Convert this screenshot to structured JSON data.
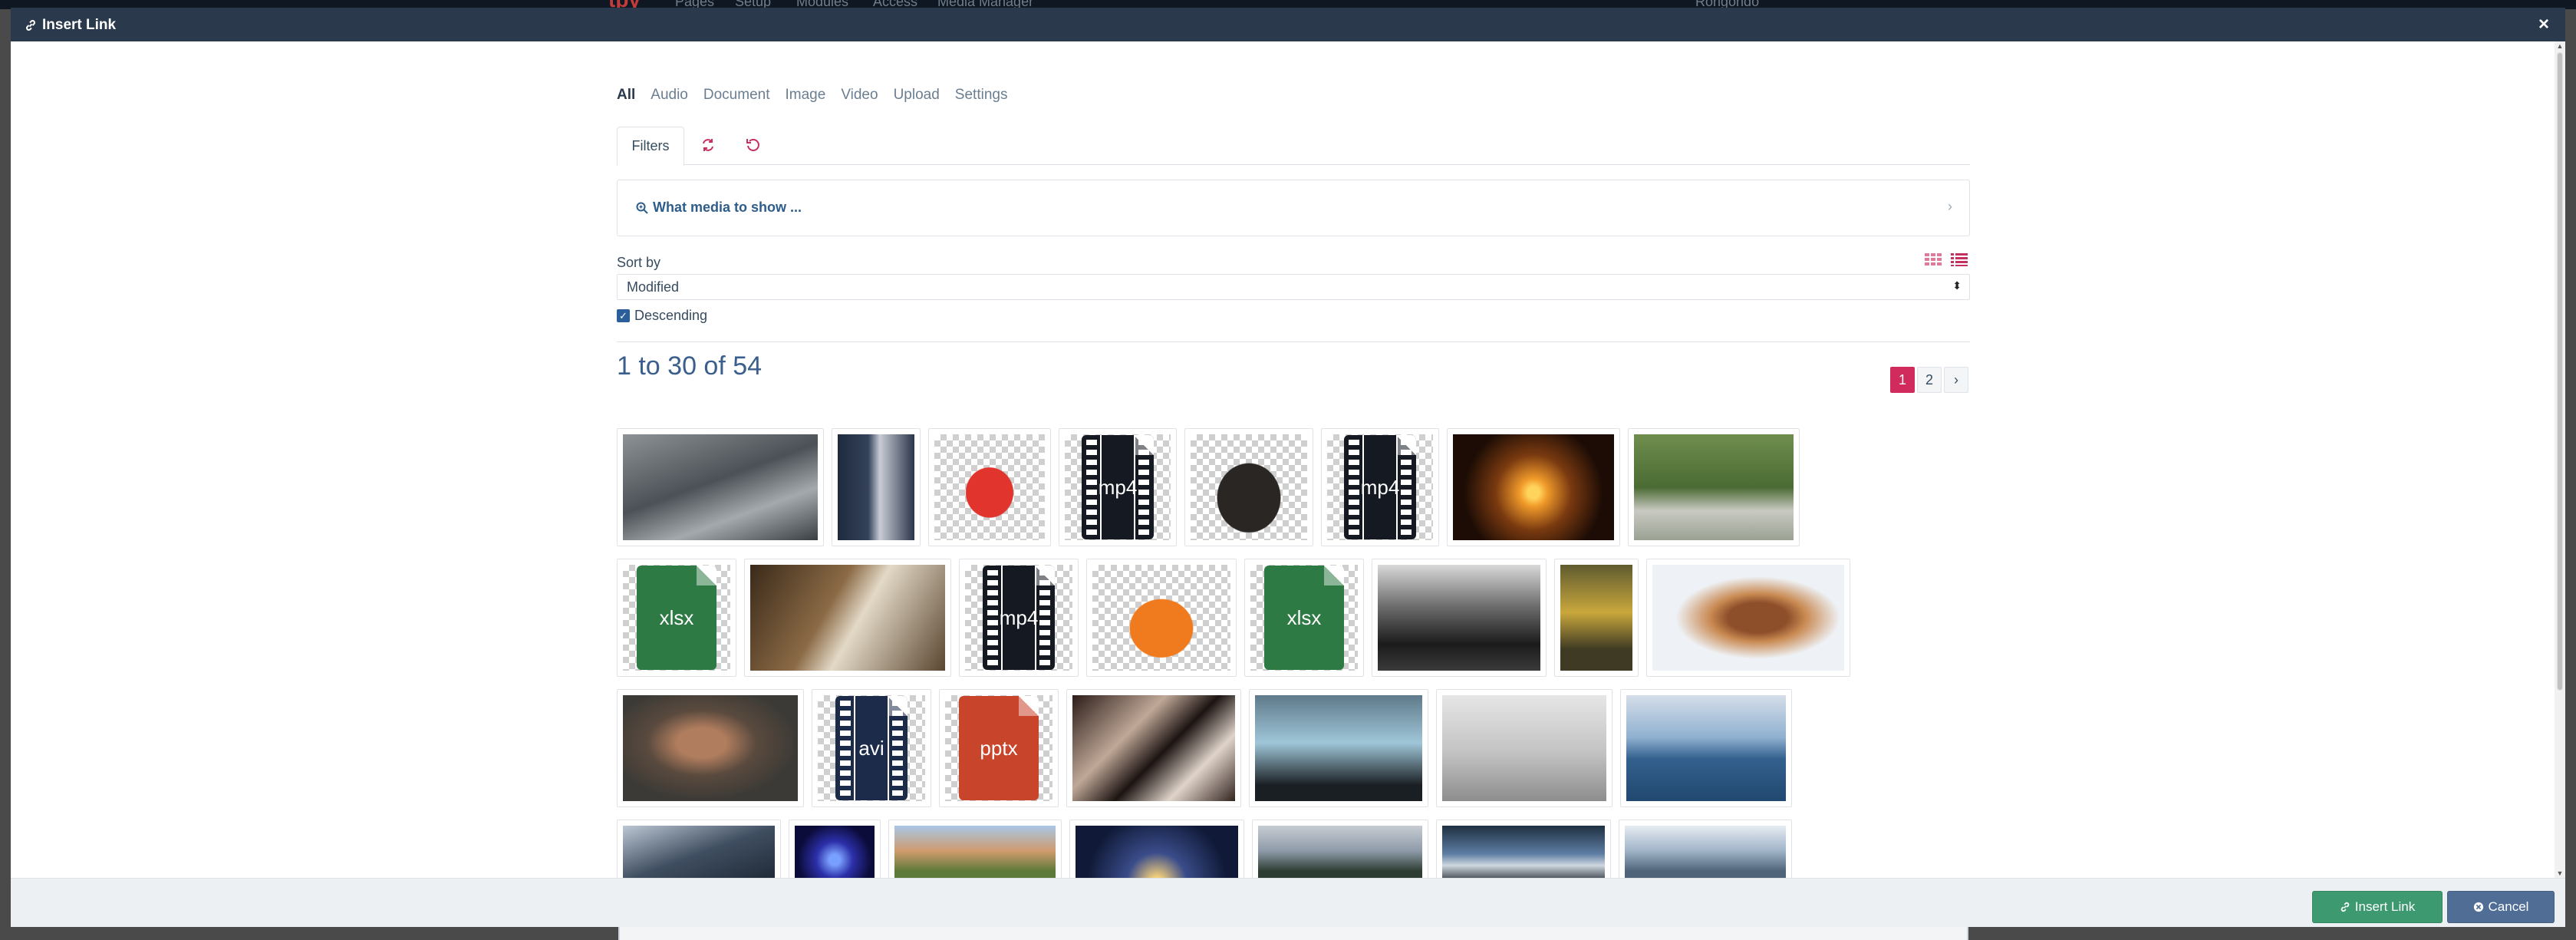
{
  "modal": {
    "title": "Insert Link",
    "close_symbol": "×"
  },
  "background_app": {
    "nav_items": [
      "Pages",
      "Setup",
      "Modules",
      "Access",
      "Media Manager"
    ],
    "user": "Rongondo"
  },
  "type_tabs": [
    {
      "label": "All",
      "active": true
    },
    {
      "label": "Audio",
      "active": false
    },
    {
      "label": "Document",
      "active": false
    },
    {
      "label": "Image",
      "active": false
    },
    {
      "label": "Video",
      "active": false
    },
    {
      "label": "Upload",
      "active": false
    },
    {
      "label": "Settings",
      "active": false
    }
  ],
  "filters_tab": {
    "label": "Filters"
  },
  "filter_box": {
    "label": "What media to show ..."
  },
  "sort": {
    "label": "Sort by",
    "value": "Modified"
  },
  "descending": {
    "label": "Descending",
    "checked": true
  },
  "results": {
    "count_text": "1 to 30 of 54"
  },
  "pagination": {
    "pages": [
      "1",
      "2"
    ],
    "current": "1",
    "next_symbol": "›"
  },
  "thumbnails": [
    {
      "row": 1,
      "kind": "photo",
      "subject": "graffiti-wall"
    },
    {
      "row": 1,
      "kind": "photo",
      "subject": "woman-in-doorway"
    },
    {
      "row": 1,
      "kind": "photo",
      "subject": "red-cap"
    },
    {
      "row": 1,
      "kind": "file",
      "ext": "mp4"
    },
    {
      "row": 1,
      "kind": "photo",
      "subject": "haunted-house"
    },
    {
      "row": 1,
      "kind": "file",
      "ext": "mp4"
    },
    {
      "row": 1,
      "kind": "photo",
      "subject": "heart-hands-sunset"
    },
    {
      "row": 1,
      "kind": "photo",
      "subject": "walking-shoes-park"
    },
    {
      "row": 2,
      "kind": "file",
      "ext": "xlsx"
    },
    {
      "row": 2,
      "kind": "photo",
      "subject": "woman-reading"
    },
    {
      "row": 2,
      "kind": "file",
      "ext": "mp4"
    },
    {
      "row": 2,
      "kind": "photo",
      "subject": "orange-sneaker"
    },
    {
      "row": 2,
      "kind": "file",
      "ext": "xlsx"
    },
    {
      "row": 2,
      "kind": "photo",
      "subject": "car-interior"
    },
    {
      "row": 2,
      "kind": "photo",
      "subject": "woman-yellow"
    },
    {
      "row": 2,
      "kind": "photo",
      "subject": "waffles-berries"
    },
    {
      "row": 3,
      "kind": "photo",
      "subject": "portrait-woman"
    },
    {
      "row": 3,
      "kind": "file",
      "ext": "avi"
    },
    {
      "row": 3,
      "kind": "file",
      "ext": "pptx"
    },
    {
      "row": 3,
      "kind": "photo",
      "subject": "architecture-abstract"
    },
    {
      "row": 3,
      "kind": "photo",
      "subject": "blue-car"
    },
    {
      "row": 3,
      "kind": "photo",
      "subject": "man-on-beach"
    },
    {
      "row": 3,
      "kind": "photo",
      "subject": "whale-breach"
    },
    {
      "row": 4,
      "kind": "photo",
      "subject": "city-buildings"
    },
    {
      "row": 4,
      "kind": "photo",
      "subject": "phone-neon"
    },
    {
      "row": 4,
      "kind": "photo",
      "subject": "palm-building"
    },
    {
      "row": 4,
      "kind": "photo",
      "subject": "skyscrapers-up"
    },
    {
      "row": 4,
      "kind": "photo",
      "subject": "mountains-mist"
    },
    {
      "row": 4,
      "kind": "photo",
      "subject": "classic-car-tail"
    },
    {
      "row": 4,
      "kind": "photo",
      "subject": "car-dashboard"
    }
  ],
  "footer": {
    "insert_label": "Insert Link",
    "cancel_label": "Cancel"
  },
  "colors": {
    "accent_pink": "#d12a5c",
    "insert_button": "#3d9970",
    "cancel_button": "#4f6d95",
    "titlebar": "#2a3a4c"
  },
  "icons": [
    "link-icon",
    "close-icon",
    "refresh-icon",
    "undo-icon",
    "search-plus-icon",
    "chevron-right-icon",
    "grid-view-icon",
    "list-view-icon",
    "checkbox-icon",
    "cancel-circle-icon"
  ]
}
